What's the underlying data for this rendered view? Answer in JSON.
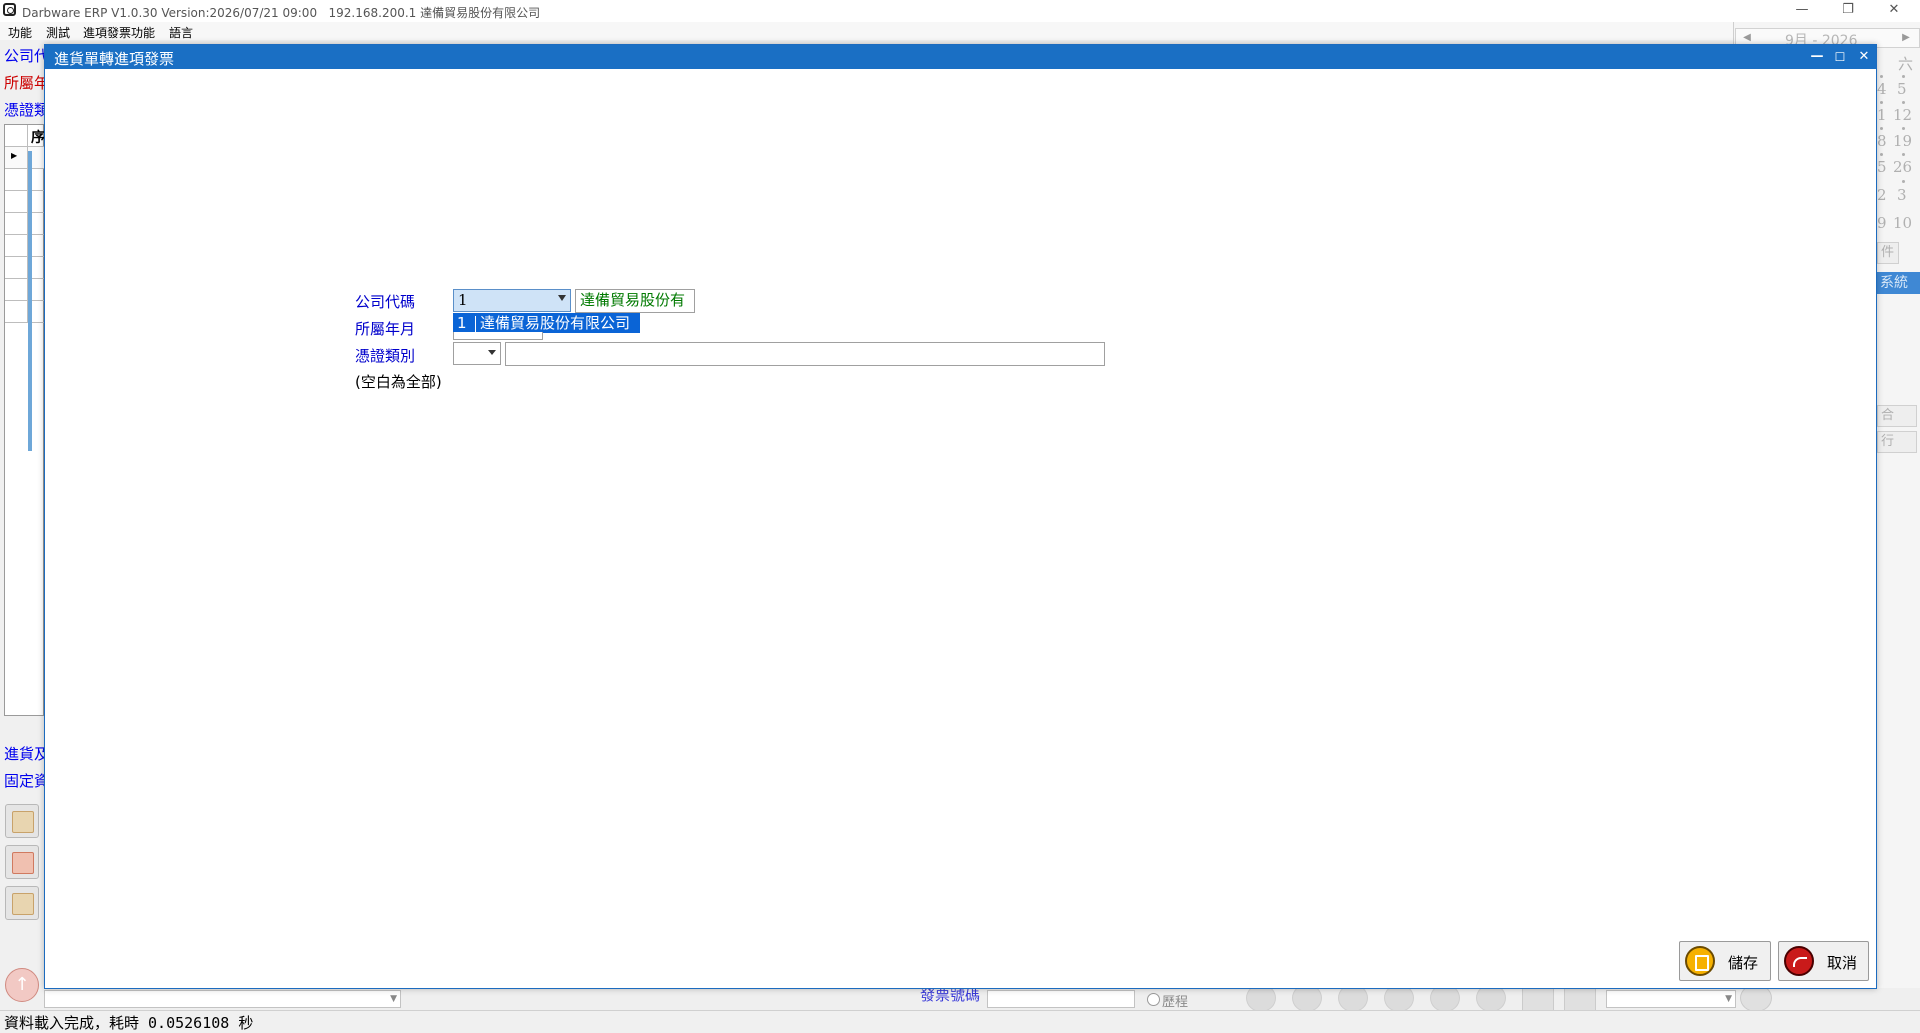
{
  "app": {
    "title": "Darbware ERP V1.0.30 Version:2026/07/21 09:00   192.168.200.1 達備貿易股份有限公司",
    "menu": [
      "功能",
      "測試",
      "進項發票功能",
      "語言"
    ],
    "restore_icon": "❐",
    "minimize_icon": "—",
    "close_icon": "✕"
  },
  "background": {
    "labels": [
      {
        "text": "公司代",
        "color": "#0000ee"
      },
      {
        "text": "所屬年",
        "color": "#cc0000"
      },
      {
        "text": "憑證類",
        "color": "#0000ee"
      }
    ],
    "grid_header": "序",
    "lower_labels": [
      "進貨及",
      "固定資"
    ],
    "calendar": {
      "month_text": "9月 - 2026",
      "weekday_partial": "六",
      "prev": "◀",
      "next": "▶",
      "col1": [
        "4",
        "1",
        "8",
        "5",
        "2",
        "9"
      ],
      "col2": [
        "5",
        "12",
        "19",
        "26",
        "3",
        "10"
      ]
    },
    "panel_buttons": [
      "件",
      "合",
      "行"
    ],
    "system_tab": "系統",
    "bottom_field_label": "發票號碼",
    "history_label": "歷程"
  },
  "dialog": {
    "title": "進貨單轉進項發票",
    "minimize": "—",
    "maximize": "☐",
    "close": "✕",
    "company_label": "公司代碼",
    "company_value": "1",
    "company_name": "達備貿易股份有",
    "dropdown_option": {
      "code": "1",
      "name": "達備貿易股份有限公司"
    },
    "period_label": "所屬年月",
    "voucher_label": "憑證類別",
    "note": "(空白為全部)",
    "save_button": "儲存",
    "cancel_button": "取消"
  },
  "status": "資料載入完成，耗時 0.0526108 秒"
}
